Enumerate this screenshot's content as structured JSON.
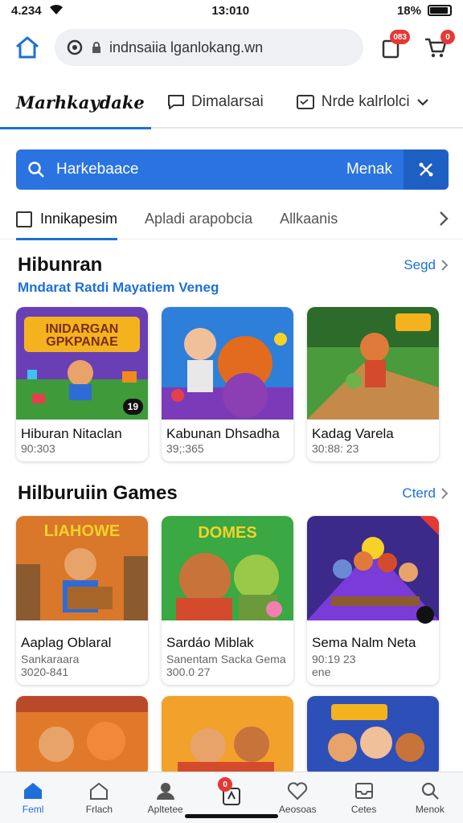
{
  "status": {
    "time_left": "4.234",
    "time_center": "13:010",
    "battery": "18%"
  },
  "browser": {
    "url": "indnsaiia lganlokang.wn",
    "tabs_badge": "083",
    "cart_badge": "0"
  },
  "top_tabs": {
    "brand": "Marhkaydake",
    "tab2": "Dimalarsai",
    "tab3": "Nrde kalrlolci"
  },
  "search": {
    "placeholder": "Harkebaace",
    "button": "Menak"
  },
  "filters": {
    "f1": "Innikapesim",
    "f2": "Apladi arapobcia",
    "f3": "Allkaanis"
  },
  "section1": {
    "title": "Hibunran",
    "link": "Segd",
    "subtitle": "Mndarat Ratdi Mayatiem Veneg",
    "cards": [
      {
        "title": "Hiburan Nitaclan",
        "meta": "90:303",
        "badge": "19",
        "banner": "INIDARGAN GPKPANAE"
      },
      {
        "title": "Kabunan Dhsadha",
        "meta": "39;:365"
      },
      {
        "title": "Kadag Varela",
        "meta": "30:88: 23"
      }
    ]
  },
  "section2": {
    "title": "Hilburuiin Games",
    "link": "Cterd",
    "cards": [
      {
        "title": "Aaplag Oblaral",
        "sub": "Sankaraara",
        "meta": "3020-841",
        "banner": "LIAHOWE"
      },
      {
        "title": "Sardáo Miblak",
        "sub": "Sanentam Sacka Gema",
        "meta": "300.0 27",
        "banner": "DOMES"
      },
      {
        "title": "Sema Nalm Neta",
        "sub": "90:19 23",
        "meta": "ene"
      }
    ]
  },
  "bottom_nav": {
    "items": [
      "Feml",
      "Frlach",
      "Apltetee",
      "",
      "Aeosoas",
      "Cetes",
      "Menok"
    ],
    "center_badge": "0"
  },
  "colors": {
    "accent": "#1e6fd9",
    "search_bg": "#2a73e0",
    "badge": "#e53935"
  }
}
